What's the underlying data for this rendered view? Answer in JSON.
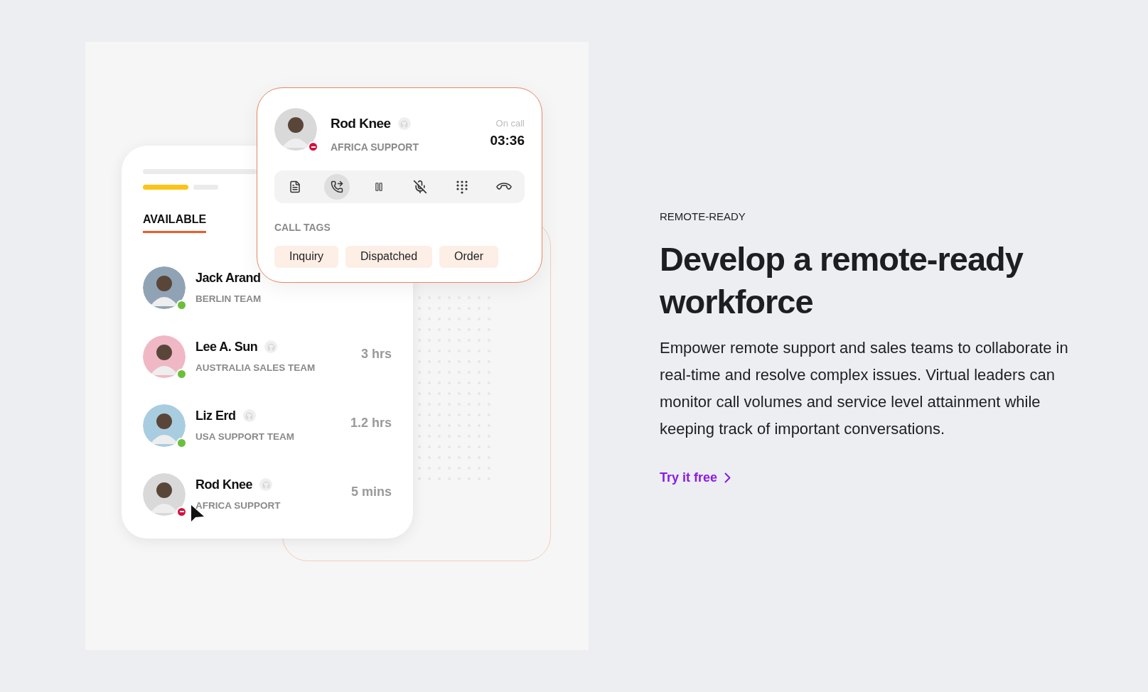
{
  "illustration": {
    "agents_card": {
      "tab": {
        "label": "AVAILABLE",
        "selected": true
      },
      "agents": [
        {
          "name": "Jack Arand",
          "team": "BERLIN TEAM",
          "available": true,
          "headset": false
        },
        {
          "name": "Lee A. Sun",
          "team": "AUSTRALIA SALES TEAM",
          "time": "3 hrs",
          "available": true,
          "headset": true
        },
        {
          "name": "Liz Erd",
          "team": "USA SUPPORT TEAM",
          "time": "1.2 hrs",
          "available": true,
          "headset": true
        },
        {
          "name": "Rod Knee",
          "team": "AFRICA SUPPORT",
          "time": "5 mins",
          "available": false,
          "headset": true
        }
      ]
    },
    "call_card": {
      "name": "Rod Knee",
      "team": "AFRICA SUPPORT",
      "available": false,
      "state": "On call",
      "timer": "03:36",
      "controls": [
        {
          "kind": "notes",
          "selected": false
        },
        {
          "kind": "transfer",
          "selected": true
        },
        {
          "kind": "pause",
          "selected": false
        },
        {
          "kind": "mute",
          "selected": false
        },
        {
          "kind": "dialpad",
          "selected": false
        },
        {
          "kind": "hangup",
          "selected": false
        }
      ],
      "tags_label": "CALL TAGS",
      "tags": [
        "Inquiry",
        "Dispatched",
        "Order"
      ]
    }
  },
  "section_label": "REMOTE-READY",
  "heading": "Develop a remote-ready workforce",
  "body": "Empower remote support and sales teams to collaborate in real-time and resolve complex issues. Virtual leaders can monitor call volumes and service level attainment while keeping track of important conversations.",
  "link": {
    "label": "Try it free"
  }
}
